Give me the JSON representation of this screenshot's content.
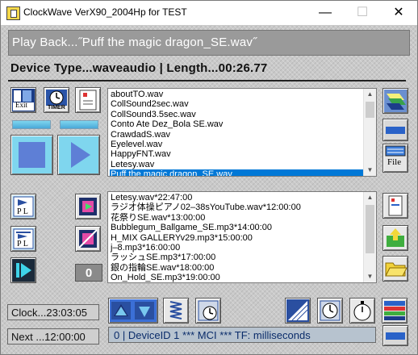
{
  "window": {
    "title": "ClockWave VerX90_2004Hp for TEST",
    "minimize_glyph": "—",
    "maximize_glyph": "☐",
    "close_glyph": "✕"
  },
  "playback": {
    "text": "Play Back...˝Puff the magic dragon_SE.wav˝"
  },
  "device": {
    "text": "Device Type...waveaudio  |  Length...00:26.77"
  },
  "buttons": {
    "exit_label": "Exit",
    "timer_label": "TIMER",
    "file_label": "File",
    "pl1_label": "P L",
    "pl2_label": "P L"
  },
  "progress": {
    "left_fill": 1.0,
    "right_fill": 1.0
  },
  "file_list": {
    "items": [
      "aboutTO.wav",
      "CollSound2sec.wav",
      "CollSound3.5sec.wav",
      "Conto Ate Dez_Bola SE.wav",
      "CrawdadS.wav",
      "Eyelevel.wav",
      "HappyFNT.wav",
      "Letesy.wav",
      "Puff the magic dragon_SE.wav"
    ],
    "selected_index": 8
  },
  "schedule_list": {
    "items": [
      "Letesy.wav*22:47:00",
      "ラジオ体操ピアノ02–38sYouTube.wav*12:00:00",
      "花祭りSE.wav*13:00:00",
      "Bubblegum_Ballgame_SE.mp3*14:00:00",
      "H_MIX GALLERYv29.mp3*15:00:00",
      "j–8.mp3*16:00:00",
      "ラッシュSE.mp3*17:00:00",
      "銀の指輪SE.wav*18:00:00",
      "On_Hold_SE.mp3*19:00:00"
    ]
  },
  "counter": {
    "value": "0"
  },
  "clock": {
    "text": "Clock...23:03:05"
  },
  "next": {
    "text": "Next ...12:00:00"
  },
  "status": {
    "text": "0 | DeviceID 1 *** MCI ***  TF: milliseconds"
  },
  "icons": {
    "exit": "exit-door-icon",
    "timer": "timer-clock-icon",
    "remote": "remote-control-icon",
    "stop": "stop-icon",
    "play": "play-icon",
    "edit": "edit-list-icon",
    "minus_top": "minus-icon",
    "file": "file-keyboard-icon",
    "pl1": "playlist-icon",
    "pl2": "playlist-alt-icon",
    "next_track": "next-track-icon",
    "add_schedule": "add-schedule-icon",
    "remove_schedule": "remove-schedule-icon",
    "up_down": "up-down-arrows-icon",
    "spring": "spring-icon",
    "clock_timer": "clock-timer-icon",
    "gauge": "gauge-icon",
    "watch": "watch-icon",
    "stopwatch": "stopwatch-icon",
    "color_bars": "color-bars-icon",
    "device_remote": "device-remote-icon",
    "upload": "upload-folder-icon",
    "open_folder": "open-folder-icon",
    "minus_bottom": "minus-icon"
  }
}
